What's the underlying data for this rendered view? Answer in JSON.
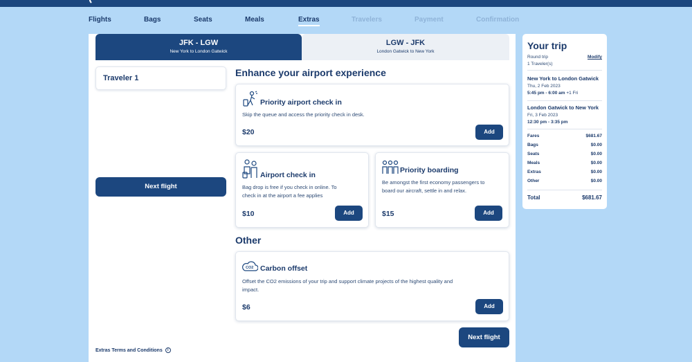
{
  "header": {
    "steps": [
      {
        "label": "Flights",
        "state": "done"
      },
      {
        "label": "Bags",
        "state": "done"
      },
      {
        "label": "Seats",
        "state": "done"
      },
      {
        "label": "Meals",
        "state": "done"
      },
      {
        "label": "Extras",
        "state": "active"
      },
      {
        "label": "Travelers",
        "state": "disabled"
      },
      {
        "label": "Payment",
        "state": "disabled"
      },
      {
        "label": "Confirmation",
        "state": "disabled"
      }
    ]
  },
  "routes": [
    {
      "code": "JFK - LGW",
      "sub": "New York to London Gatwick",
      "active": true
    },
    {
      "code": "LGW - JFK",
      "sub": "London Gatwick to New York",
      "active": false
    }
  ],
  "traveler": {
    "label": "Traveler 1"
  },
  "left_next_label": "Next flight",
  "sections": {
    "enhance_title": "Enhance your airport experience",
    "other_title": "Other"
  },
  "cards": {
    "priority_checkin": {
      "icon": "priority-check-in-icon",
      "title": "Priority airport check in",
      "desc": "Skip the queue and access the priority check in desk.",
      "price": "$20",
      "add_label": "Add"
    },
    "airport_checkin": {
      "icon": "airport-check-in-icon",
      "title": "Airport check in",
      "desc_line1": "Bag drop is free if you check in online. To",
      "desc_line2": "check in at the airport a fee applies",
      "price": "$10",
      "add_label": "Add"
    },
    "priority_boarding": {
      "icon": "priority-boarding-icon",
      "title": "Priority boarding",
      "desc_line1": "Be amongst the first economy passengers to",
      "desc_line2": "board our aircraft, settle in and relax.",
      "price": "$15",
      "add_label": "Add"
    },
    "carbon_offset": {
      "icon": "co2-cloud-icon",
      "icon_text": "CO2",
      "title": "Carbon offset",
      "desc_line1": "Offset the CO2 emissions of your trip and support climate projects of the highest quality and",
      "desc_line2": "impact.",
      "price": "$6",
      "add_label": "Add"
    }
  },
  "bottom_next_label": "Next flight",
  "terms": {
    "label": "Extras Terms and Conditions",
    "icon": "info-icon",
    "icon_glyph": "i"
  },
  "trip": {
    "title": "Your trip",
    "type": "Round trip",
    "travelers": "1 Traveler(s)",
    "modify": "Modify",
    "legs": [
      {
        "title": "New York to London Gatwick",
        "date": "Thu, 2 Feb 2023",
        "time": "5:45 pm - 6:00 am",
        "next_day": " +1 Fri"
      },
      {
        "title": "London Gatwick to New York",
        "date": "Fri, 3 Feb 2023",
        "time": "12:30 pm - 3:35 pm",
        "next_day": ""
      }
    ],
    "fees": [
      {
        "label": "Fares",
        "value": "$681.67"
      },
      {
        "label": "Bags",
        "value": "$0.00"
      },
      {
        "label": "Seats",
        "value": "$0.00"
      },
      {
        "label": "Meals",
        "value": "$0.00"
      },
      {
        "label": "Extras",
        "value": "$0.00"
      },
      {
        "label": "Other",
        "value": "$0.00"
      }
    ],
    "total_label": "Total",
    "total_value": "$681.67"
  },
  "colors": {
    "background": "#b3d8f7",
    "primary": "#1c477f",
    "text": "#1b3a6b",
    "disabled_step": "#8fb3d8"
  }
}
